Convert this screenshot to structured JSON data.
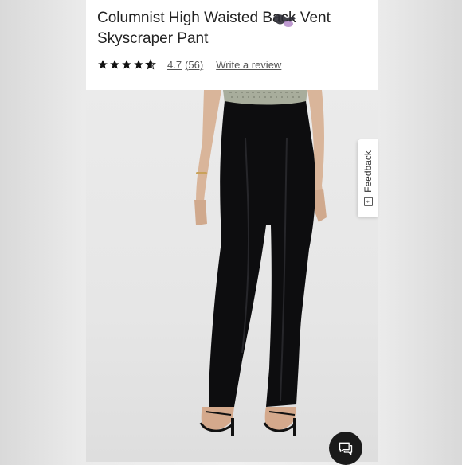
{
  "product": {
    "title": "Columnist High Waisted Back Vent Skyscraper Pant",
    "rating_value": "4.7",
    "review_count": "(56)",
    "write_review_label": "Write a review",
    "stars": 4.7
  },
  "feedback": {
    "label": "Feedback",
    "icon": "feedback-icon"
  },
  "chat": {
    "icon": "chat-icon"
  }
}
